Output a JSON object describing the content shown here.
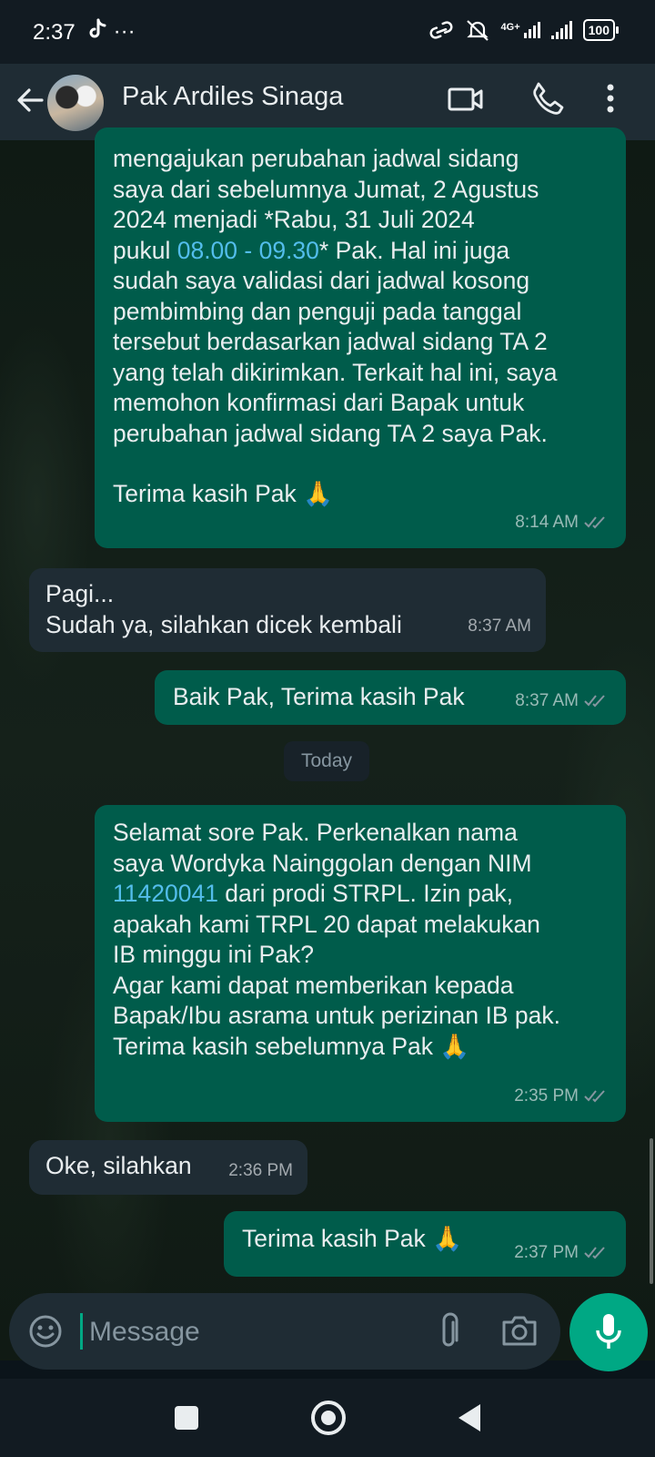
{
  "status_bar": {
    "time": "2:37",
    "left_icons": [
      "tiktok-icon",
      "more-dots"
    ],
    "left_dots": "···",
    "network": "4G+",
    "battery": "100"
  },
  "header": {
    "contact_name": "Pak Ardiles Sinaga",
    "icons": [
      "back-arrow-icon",
      "avatar",
      "video-call-icon",
      "phone-icon",
      "more-vert-icon"
    ]
  },
  "messages": [
    {
      "direction": "out",
      "lines": [
        "mengajukan perubahan jadwal sidang",
        "saya dari sebelumnya Jumat, 2 Agustus",
        "2024 menjadi *Rabu, 31 Juli 2024",
        "pukul ",
        "sudah saya validasi dari jadwal kosong",
        "pembimbing dan penguji pada tanggal",
        "tersebut berdasarkan jadwal sidang TA 2",
        "yang telah dikirimkan. Terkait hal ini, saya",
        "memohon konfirmasi dari Bapak untuk",
        "perubahan jadwal sidang TA 2 saya Pak.",
        "",
        "Terima kasih Pak 🙏"
      ],
      "link_text": "08.00 - 09.30",
      "after_link": "* Pak. Hal ini juga",
      "time": "8:14 AM",
      "status": "read"
    },
    {
      "direction": "in",
      "lines": [
        "Pagi...",
        "Sudah ya, silahkan dicek kembali"
      ],
      "time": "8:37 AM"
    },
    {
      "direction": "out",
      "lines": [
        "Baik Pak, Terima kasih Pak"
      ],
      "time": "8:37 AM",
      "status": "read"
    },
    {
      "direction": "out",
      "lines": [
        "Selamat sore Pak. Perkenalkan nama",
        "saya Wordyka Nainggolan dengan NIM",
        "",
        "apakah kami TRPL 20 dapat melakukan",
        "IB minggu ini Pak?",
        "Agar kami dapat memberikan kepada",
        "Bapak/Ibu asrama untuk perizinan IB pak.",
        "Terima kasih sebelumnya Pak 🙏"
      ],
      "link_text": "11420041",
      "after_link": " dari prodi STRPL. Izin pak,",
      "time": "2:35 PM",
      "status": "read"
    },
    {
      "direction": "in",
      "lines": [
        "Oke, silahkan"
      ],
      "time": "2:36 PM"
    },
    {
      "direction": "out",
      "lines": [
        "Terima kasih Pak 🙏"
      ],
      "time": "2:37 PM",
      "status": "read"
    }
  ],
  "date_separator": "Today",
  "input": {
    "placeholder": "Message",
    "value": ""
  },
  "colors": {
    "outgoing_bubble": "#005c4b",
    "incoming_bubble": "#1f2c34",
    "accent": "#00a884",
    "link": "#53bdeb",
    "read_ticks": "#8696a0"
  }
}
